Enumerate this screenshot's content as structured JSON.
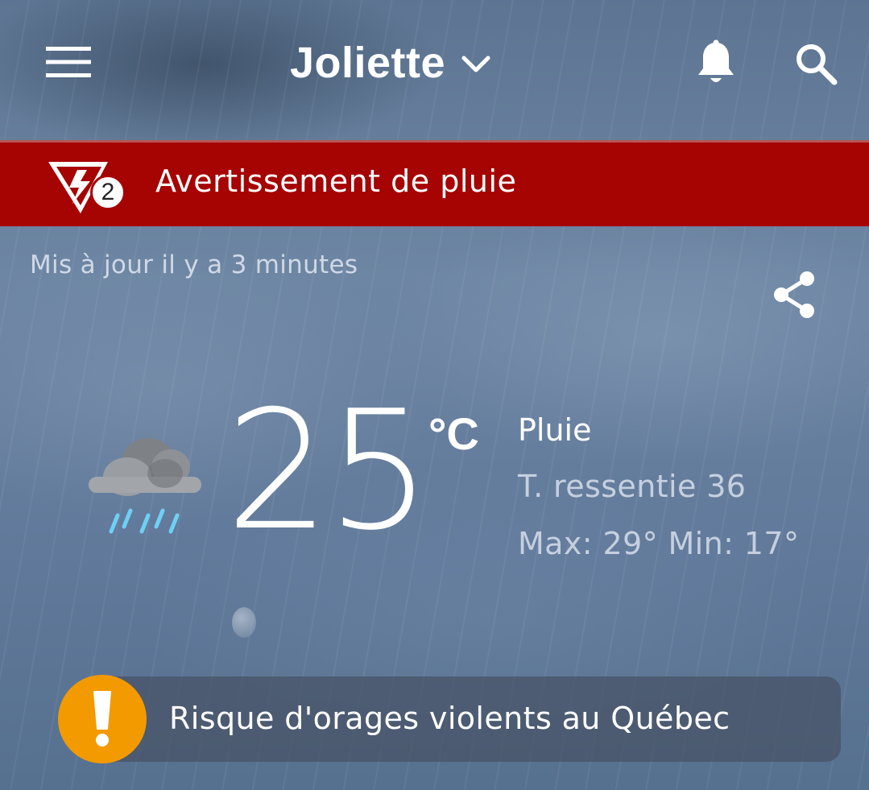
{
  "header": {
    "location": "Joliette",
    "icons": {
      "menu": "menu-icon",
      "dropdown": "chevron-down-icon",
      "notifications": "bell-icon",
      "search": "search-icon"
    }
  },
  "warning": {
    "badge_level": "2",
    "text": "Avertissement de pluie",
    "color": "#a60303"
  },
  "updated": "Mis à jour il y a 3 minutes",
  "current": {
    "temperature": "25",
    "unit": "°C",
    "condition": "Pluie",
    "feels_like": "T. ressentie 36",
    "max_min": "Max: 29° Min: 17°",
    "icon": "cloud-rain-icon"
  },
  "alert": {
    "text": "Risque d'orages violents au Québec",
    "color": "#f29a00"
  }
}
